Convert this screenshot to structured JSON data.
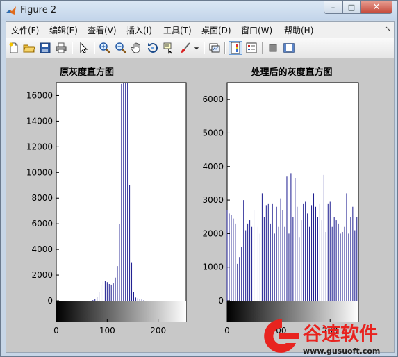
{
  "window": {
    "title": "Figure 2",
    "min_label": "–",
    "max_label": "□",
    "close_label": "✕"
  },
  "menu": {
    "items": [
      "文件(F)",
      "编辑(E)",
      "查看(V)",
      "插入(I)",
      "工具(T)",
      "桌面(D)",
      "窗口(W)",
      "帮助(H)"
    ],
    "overflow": "↘"
  },
  "toolbar": {
    "buttons": [
      "new-file",
      "open-folder",
      "save",
      "print",
      "pointer",
      "zoom-in",
      "zoom-out",
      "pan-hand",
      "rotate-3d",
      "data-cursor",
      "brush",
      "link-plot",
      "colorbar",
      "legend",
      "hide-plot-tools",
      "show-plot-tools"
    ]
  },
  "chart_data": [
    {
      "type": "bar",
      "title": "原灰度直方图",
      "xlim": [
        0,
        255
      ],
      "ylim": [
        0,
        17000
      ],
      "yticks": [
        0,
        2000,
        4000,
        6000,
        8000,
        10000,
        12000,
        14000,
        16000
      ],
      "xticks": [
        0,
        100,
        200
      ],
      "x": [
        72,
        76,
        80,
        84,
        88,
        92,
        96,
        100,
        104,
        108,
        112,
        116,
        120,
        124,
        128,
        132,
        136,
        140,
        144,
        148,
        152,
        156,
        160,
        164,
        168,
        172
      ],
      "values": [
        50,
        150,
        300,
        700,
        1200,
        1500,
        1550,
        1450,
        1300,
        1250,
        1350,
        1800,
        2700,
        6000,
        16900,
        17000,
        17000,
        17000,
        9000,
        3000,
        700,
        250,
        200,
        150,
        100,
        50
      ],
      "colorbar": "grayscale"
    },
    {
      "type": "bar",
      "title": "处理后的灰度直方图",
      "xlim": [
        0,
        255
      ],
      "ylim": [
        0,
        6500
      ],
      "yticks": [
        0,
        1000,
        2000,
        3000,
        4000,
        5000,
        6000
      ],
      "xticks": [
        0,
        100,
        200
      ],
      "x": [
        0,
        4,
        8,
        12,
        16,
        20,
        24,
        28,
        32,
        36,
        40,
        44,
        48,
        52,
        56,
        60,
        64,
        68,
        72,
        76,
        80,
        84,
        88,
        92,
        96,
        100,
        104,
        108,
        112,
        116,
        120,
        124,
        128,
        132,
        136,
        140,
        144,
        148,
        152,
        156,
        160,
        164,
        168,
        172,
        176,
        180,
        184,
        188,
        192,
        196,
        200,
        204,
        208,
        212,
        216,
        220,
        224,
        228,
        232,
        236,
        240,
        244,
        248,
        252
      ],
      "values": [
        2700,
        2600,
        2550,
        2450,
        2300,
        1100,
        1300,
        1600,
        3000,
        2100,
        2300,
        2400,
        2200,
        2700,
        2500,
        2200,
        2000,
        3200,
        2500,
        2850,
        2900,
        2300,
        2900,
        2000,
        2800,
        2200,
        3050,
        2700,
        2200,
        3700,
        2000,
        3800,
        2500,
        3650,
        2800,
        1900,
        2400,
        2900,
        2950,
        2600,
        2200,
        2850,
        3200,
        2800,
        2500,
        2900,
        2400,
        3750,
        2050,
        2900,
        2950,
        2200,
        2500,
        2400,
        2300,
        2000,
        2050,
        2200,
        3200,
        2000,
        2500,
        2800,
        2100,
        2500
      ],
      "colorbar": "grayscale"
    }
  ],
  "axes": {
    "left_yticks": [
      "0",
      "2000",
      "4000",
      "6000",
      "8000",
      "10000",
      "12000",
      "14000",
      "16000"
    ],
    "right_yticks": [
      "0",
      "1000",
      "2000",
      "3000",
      "4000",
      "5000",
      "6000"
    ],
    "xticks": [
      "0",
      "100",
      "200"
    ]
  },
  "watermark": {
    "brand": "谷速软件",
    "url": "www.gusuoft.com",
    "color": "#e8231f"
  }
}
